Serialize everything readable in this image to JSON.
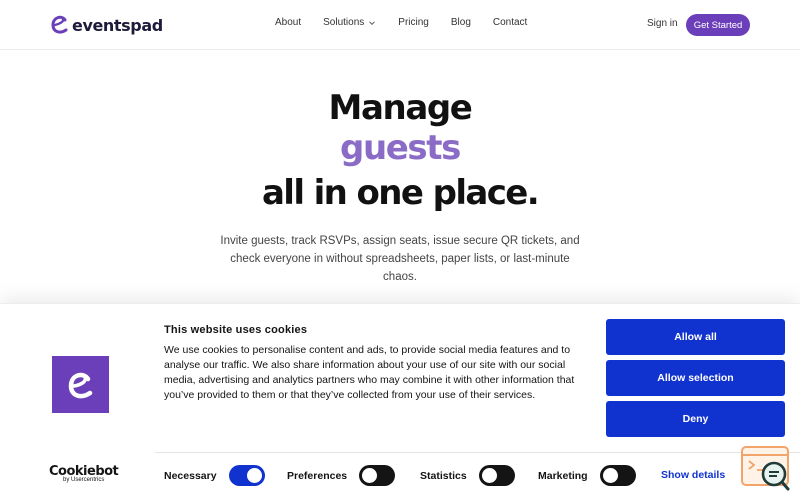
{
  "header": {
    "brand": "eventspad",
    "nav": [
      "About",
      "Solutions",
      "Pricing",
      "Blog",
      "Contact"
    ],
    "signin": "Sign in",
    "cta": "Get Started"
  },
  "hero": {
    "line1": "Manage",
    "line2": "guests",
    "line3": "all in one place.",
    "subtitle": "Invite guests, track RSVPs, assign seats, issue secure QR tickets, and check everyone in without spreadsheets, paper lists, or last-minute chaos."
  },
  "cookie_banner": {
    "title": "This website uses cookies",
    "body": "We use cookies to personalise content and ads, to provide social media features and to analyse our traffic. We also share information about your use of our site with our social media, advertising and analytics partners who may combine it with other information that you’ve provided to them or that they’ve collected from your use of their services.",
    "buttons": {
      "allow_all": "Allow all",
      "allow_selection": "Allow selection",
      "deny": "Deny"
    },
    "provider": {
      "name": "Cookiebot",
      "by": "by Usercentrics"
    },
    "toggles": [
      {
        "label": "Necessary",
        "on": true
      },
      {
        "label": "Preferences",
        "on": false
      },
      {
        "label": "Statistics",
        "on": false
      },
      {
        "label": "Marketing",
        "on": false
      }
    ],
    "show_details": "Show details"
  },
  "colors": {
    "brand": "#6b3fb9",
    "accent_text": "#8a6bc6",
    "button_blue": "#1032cf"
  }
}
